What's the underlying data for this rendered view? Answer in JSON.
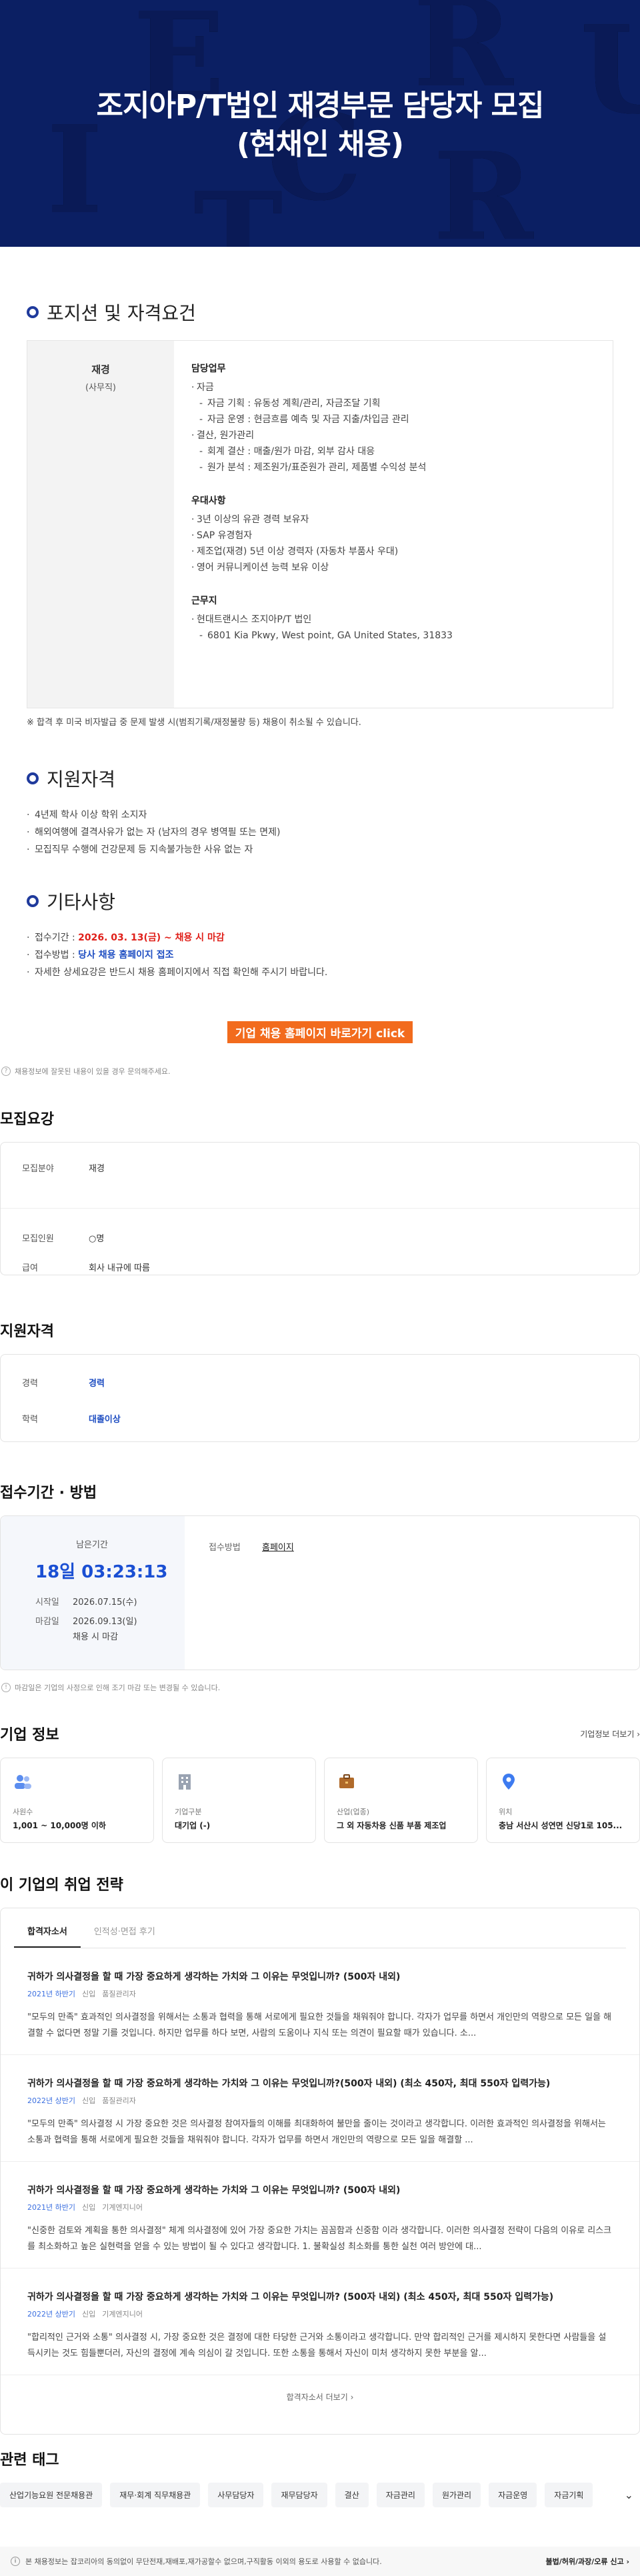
{
  "hero": {
    "title_line1": "조지아P/T법인 재경부문 담당자 모집",
    "title_line2": "(현채인 채용)",
    "letters": [
      "E",
      "C",
      "R",
      "I",
      "T",
      "U",
      "R"
    ]
  },
  "position": {
    "heading": "포지션 및 자격요건",
    "role": "재경",
    "role_sub": "(사무직)",
    "groups": [
      {
        "title": "담당업무",
        "lines": [
          {
            "level": 1,
            "text": "자금"
          },
          {
            "level": 2,
            "text": "자금 기획 : 유동성 계획/관리, 자금조달 기획"
          },
          {
            "level": 2,
            "text": "자금 운영 : 현금흐름 예측 및 자금 지출/차입금 관리"
          },
          {
            "level": 1,
            "text": "결산, 원가관리"
          },
          {
            "level": 2,
            "text": "회계 결산 : 매출/원가 마감, 외부 감사 대응"
          },
          {
            "level": 2,
            "text": "원가 분석 : 제조원가/표준원가 관리, 제품별 수익성 분석"
          }
        ]
      },
      {
        "title": "우대사항",
        "lines": [
          {
            "level": 1,
            "text": "3년 이상의 유관 경력 보유자"
          },
          {
            "level": 1,
            "text": "SAP 유경험자"
          },
          {
            "level": 1,
            "text": "제조업(재경) 5년 이상 경력자 (자동차 부품사 우대)"
          },
          {
            "level": 1,
            "text": "영어 커뮤니케이션 능력 보유 이상"
          }
        ]
      },
      {
        "title": "근무지",
        "lines": [
          {
            "level": 1,
            "text": "현대트랜시스 조지아P/T 법인"
          },
          {
            "level": 2,
            "text": "6801 Kia Pkwy, West point, GA United States, 31833"
          }
        ]
      }
    ],
    "note": "※ 합격 후 미국 비자발급 중 문제 발생 시(범죄기록/재정불량 등) 채용이 취소될 수 있습니다."
  },
  "qualification": {
    "heading": "지원자격",
    "lines": [
      "4년제 학사 이상 학위 소지자",
      "해외여행에 결격사유가 없는 자 (남자의 경우 병역필 또는 면제)",
      "모집직무 수행에 건강문제 등 지속불가능한 사유 없는 자"
    ]
  },
  "other": {
    "heading": "기타사항",
    "deadline_label": "접수기간 : ",
    "deadline_value": "2026. 03. 13(금) ~ 채용 시 마감",
    "method_label": "접수방법 : ",
    "method_value": "당사 채용 홈페이지 접조",
    "detail": "자세한 상세요강은 반드시 채용 홈페이지에서 직접 확인해 주시기 바랍니다."
  },
  "cta": {
    "label": "기업 채용 홈페이지 바로가기 click"
  },
  "report": {
    "text": "채용정보에 잘못된 내용이 있을 경우 문의해주세요."
  },
  "summary": {
    "title": "모집요강",
    "rows": [
      {
        "k": "모집분야",
        "v": "재경"
      },
      {
        "k": "모집인원",
        "v": "○명"
      },
      {
        "k": "급여",
        "v": "회사 내규에 따름"
      }
    ]
  },
  "requirement": {
    "title": "지원자격",
    "rows": [
      {
        "k": "경력",
        "v": "경력"
      },
      {
        "k": "학력",
        "v": "대졸이상"
      }
    ]
  },
  "apply": {
    "title": "접수기간 · 방법",
    "remain_label": "남은기간",
    "remain": "18일 03:23:13",
    "start_label": "시작일",
    "start": "2026.07.15(수)",
    "end_label": "마감일",
    "end": "2026.09.13(일)",
    "end_note": "채용 시 마감",
    "method_label": "접수방법",
    "method_value": "홈페이지",
    "notice": "마감일은 기업의 사정으로 인해 조기 마감 또는 변경될 수 있습니다."
  },
  "company": {
    "title": "기업 정보",
    "more": "기업정보 더보기",
    "cards": [
      {
        "icon": "people-icon",
        "k": "사원수",
        "v": "1,001 ~ 10,000명 이하"
      },
      {
        "icon": "building-icon",
        "k": "기업구분",
        "v": "대기업 (-)"
      },
      {
        "icon": "briefcase-icon",
        "k": "산업(업종)",
        "v": "그 외 자동차용 신품 부품 제조업"
      },
      {
        "icon": "pin-icon",
        "k": "위치",
        "v": "충남 서산시 성연면 신당1로 105..."
      }
    ]
  },
  "strategy": {
    "title": "이 기업의 취업 전략",
    "tabs": [
      "합격자소서",
      "인적성·면접 후기"
    ],
    "items": [
      {
        "q": "귀하가 의사결정을 할 때 가장 중요하게 생각하는 가치와 그 이유는 무엇입니까? (500자 내외)",
        "year": "2021년 하반기",
        "type": "신입",
        "field": "품질관리자",
        "ans": "\"모두의 만족\" 효과적인 의사결정을 위해서는 소통과 협력을 통해 서로에게 필요한 것들을 채워줘야 합니다. 각자가 업무를 하면서 개인만의 역량으로 모든 일을 해결할 수 없다면 정말 기를 것입니다. 하지만 업무를 하다 보면, 사람의 도움이나 지식 또는 의견이 필요할 때가 있습니다. 소..."
      },
      {
        "q": "귀하가 의사결정을 할 때 가장 중요하게 생각하는 가치와 그 이유는 무엇입니까?(500자 내외) (최소 450자, 최대 550자 입력가능)",
        "year": "2022년 상반기",
        "type": "신입",
        "field": "품질관리자",
        "ans": "\"모두의 만족\" 의사결정 시 가장 중요한 것은 의사결정 참여자들의 이해를 최대화하여 불만을 줄이는 것이라고 생각합니다. 이러한 효과적인 의사결정을 위해서는 소통과 협력을 통해 서로에게 필요한 것들을 채워줘야 합니다. 각자가 업무를 하면서 개인만의 역량으로 모든 일을 해결할 ..."
      },
      {
        "q": "귀하가 의사결정을 할 때 가장 중요하게 생각하는 가치와 그 이유는 무엇입니까? (500자 내외)",
        "year": "2021년 하반기",
        "type": "신입",
        "field": "기계엔지니어",
        "ans": "\"신중한 검토와 계획을 통한 의사결정\" 체계 의사결정에 있어 가장 중요한 가치는 꼼꼼함과 신중함 이라 생각합니다. 이러한 의사결정 전략이 다음의 이유로 리스크를 최소화하고 높은 실현력을 얻을 수 있는 방법이 될 수 있다고 생각합니다. 1. 불확실성 최소화를 통한 실천 여러 방안에 대..."
      },
      {
        "q": "귀하가 의사결정을 할 때 가장 중요하게 생각하는 가치와 그 이유는 무엇입니까? (500자 내외) (최소 450자, 최대 550자 입력가능)",
        "year": "2022년 상반기",
        "type": "신입",
        "field": "기계엔지니어",
        "ans": "\"합리적인 근거와 소통\" 의사결정 시, 가장 중요한 것은 결정에 대한 타당한 근거와 소통이라고 생각합니다. 만약 합리적인 근거를 제시하지 못한다면 사람들을 설득시키는 것도 힘들뿐더러, 자신의 결정에 계속 의심이 갈 것입니다. 또한 소통을 통해서 자신이 미처 생각하지 못한 부분을 알..."
      }
    ],
    "more": "합격자소서 더보기"
  },
  "tags": {
    "title": "관련 태그",
    "items": [
      "산업기능요원 전문채용관",
      "재무·회계 직무채용관",
      "사무담당자",
      "재무담당자",
      "결산",
      "자금관리",
      "원가관리",
      "자금운영",
      "자금기획"
    ]
  },
  "footer": {
    "text": "본 채용정보는 잡코리아의 동의없이 무단전재,재배포,재가공할수 없으며,구직활동 이외의 용도로 사용할 수 없습니다.",
    "right": "불법/허위/과장/오류 신고"
  }
}
